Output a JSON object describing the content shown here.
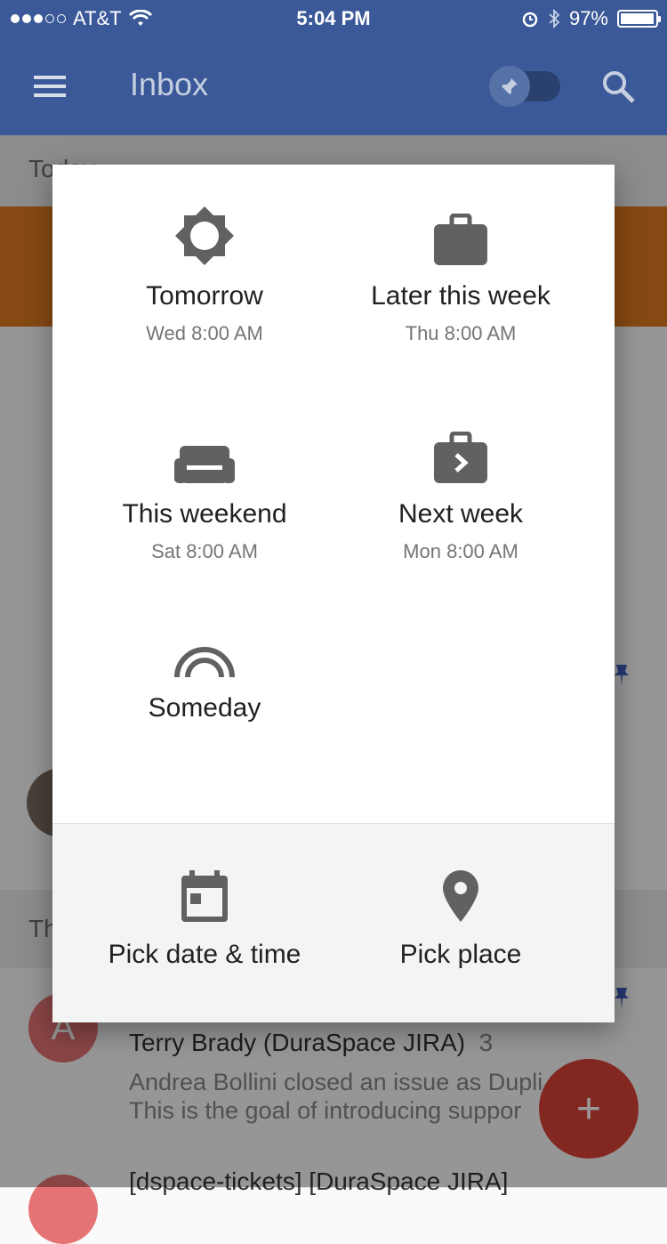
{
  "status_bar": {
    "carrier": "AT&T",
    "time": "5:04 PM",
    "battery": "97%"
  },
  "app_bar": {
    "title": "Inbox"
  },
  "background": {
    "section_today": "Today",
    "section_this_month": "Th",
    "items": [
      {
        "avatar_letter": "A",
        "sender": "Terry Brady (DuraSpace JIRA)",
        "count": "3",
        "snippet_line1": "Andrea Bollini closed an issue as Dupli",
        "snippet_line2": "This is the goal of introducing suppor"
      },
      {
        "sender": "[dspace-tickets] [DuraSpace JIRA]"
      }
    ]
  },
  "snooze_dialog": {
    "options": [
      {
        "label": "Tomorrow",
        "sub": "Wed 8:00 AM",
        "icon": "sun-icon"
      },
      {
        "label": "Later this week",
        "sub": "Thu 8:00 AM",
        "icon": "briefcase-icon"
      },
      {
        "label": "This weekend",
        "sub": "Sat 8:00 AM",
        "icon": "couch-icon"
      },
      {
        "label": "Next week",
        "sub": "Mon 8:00 AM",
        "icon": "briefcase-arrow-icon"
      },
      {
        "label": "Someday",
        "icon": "rainbow-icon"
      }
    ],
    "bottom_options": [
      {
        "label": "Pick date & time",
        "icon": "calendar-icon"
      },
      {
        "label": "Pick place",
        "icon": "location-pin-icon"
      }
    ]
  },
  "fab": {
    "label": "+"
  },
  "colors": {
    "app_bar": "#3b5998",
    "accent_orange": "#e07b21",
    "fab": "#db4437",
    "pin": "#3f5fbf"
  }
}
